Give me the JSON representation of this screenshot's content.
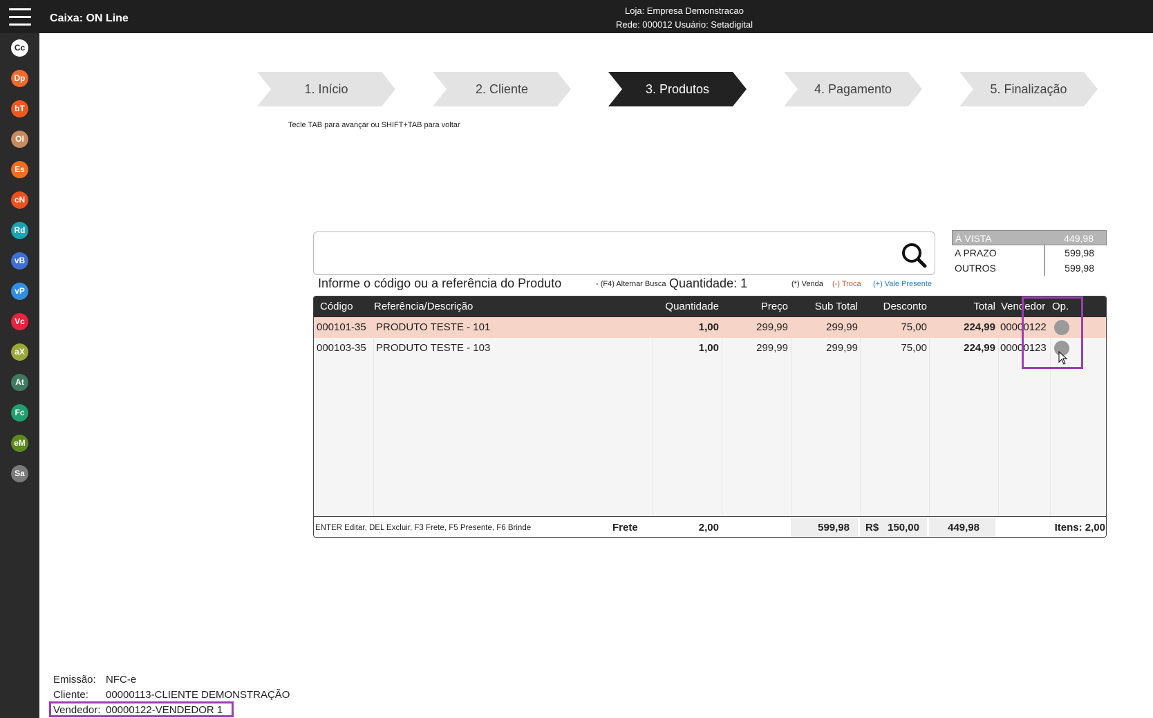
{
  "header": {
    "app_title": "Caixa: ON Line",
    "store_line": "Loja: Empresa Demonstracao",
    "network_line": "Rede: 000012 Usuário: Setadigital"
  },
  "sidebar": {
    "items": [
      {
        "label": "Cc",
        "color": "#ffffff",
        "text_color": "#222222"
      },
      {
        "label": "Dp",
        "color": "#f06a2c"
      },
      {
        "label": "bT",
        "color": "#f0581f"
      },
      {
        "label": "OI",
        "color": "#c98a5e"
      },
      {
        "label": "Es",
        "color": "#f36d1e"
      },
      {
        "label": "cN",
        "color": "#f0501d"
      },
      {
        "label": "Rd",
        "color": "#1aa2b5"
      },
      {
        "label": "vB",
        "color": "#3f6fd4"
      },
      {
        "label": "vP",
        "color": "#2f8fe3"
      },
      {
        "label": "Vc",
        "color": "#e8233d"
      },
      {
        "label": "aX",
        "color": "#9aa83a"
      },
      {
        "label": "At",
        "color": "#3f7a5e"
      },
      {
        "label": "Fc",
        "color": "#1f9e6e"
      },
      {
        "label": "eM",
        "color": "#5d8a1c"
      },
      {
        "label": "Sa",
        "color": "#7a7a7a"
      }
    ]
  },
  "steps": [
    {
      "label": "1. Início",
      "active": false
    },
    {
      "label": "2. Cliente",
      "active": false
    },
    {
      "label": "3. Produtos",
      "active": true
    },
    {
      "label": "4. Pagamento",
      "active": false
    },
    {
      "label": "5. Finalização",
      "active": false
    }
  ],
  "hint": "Tecle TAB para avançar ou SHIFT+TAB para voltar",
  "search": {
    "value": "",
    "label": "Informe o código ou a referência do Produto",
    "f4_hint": "- (F4) Alternar Busca",
    "quantity_label": "Quantidade: 1",
    "legend_venda": "(*) Venda",
    "legend_troca": "(-) Troca",
    "legend_vale": "(+) Vale Presente"
  },
  "price_summary": [
    {
      "label": "À VISTA",
      "value": "449,98",
      "selected": true
    },
    {
      "label": "A PRAZO",
      "value": "599,98",
      "selected": false
    },
    {
      "label": "OUTROS",
      "value": "599,98",
      "selected": false
    }
  ],
  "table": {
    "headers": {
      "codigo": "Código",
      "referencia": "Referência/Descrição",
      "quantidade": "Quantidade",
      "preco": "Preço",
      "subtotal": "Sub Total",
      "desconto": "Desconto",
      "total": "Total",
      "vendedor": "Vendedor",
      "op": "Op."
    },
    "rows": [
      {
        "codigo": "000101-35",
        "referencia": "PRODUTO TESTE - 101",
        "quantidade": "1,00",
        "preco": "299,99",
        "subtotal": "299,99",
        "desconto": "75,00",
        "total": "224,99",
        "vendedor": "00000122"
      },
      {
        "codigo": "000103-35",
        "referencia": "PRODUTO TESTE - 103",
        "quantidade": "1,00",
        "preco": "299,99",
        "subtotal": "299,99",
        "desconto": "75,00",
        "total": "224,99",
        "vendedor": "00000123"
      }
    ],
    "footer": {
      "shortcuts": "ENTER Editar, DEL Excluir, F3 Frete, F5 Presente, F6 Brinde",
      "frete_label": "Frete",
      "quantidade": "2,00",
      "subtotal": "599,98",
      "currency": "R$",
      "desconto": "150,00",
      "total": "449,98",
      "itens": "Itens: 2,00"
    }
  },
  "info": {
    "emissao_label": "Emissão:",
    "emissao_value": "NFC-e",
    "cliente_label": "Cliente:",
    "cliente_value": "00000113-CLIENTE DEMONSTRAÇÃO",
    "vendedor_label": "Vendedor:",
    "vendedor_value": "00000122-VENDEDOR 1"
  },
  "colors": {
    "topbar": "#1f1f1f",
    "sidebar": "#2b2b2b",
    "active_step": "#222222",
    "row_highlight": "#f7d4c8",
    "vendor_highlight_border": "#9b3fb0"
  }
}
